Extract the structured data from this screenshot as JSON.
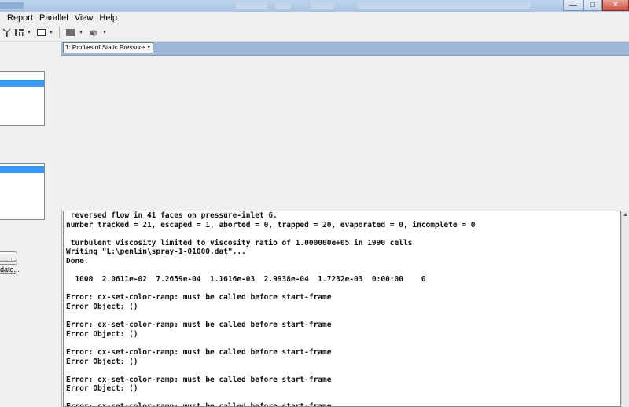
{
  "window": {
    "minimize_glyph": "—",
    "maximize_glyph": "□",
    "close_glyph": "✕"
  },
  "menu": [
    "Report",
    "Parallel",
    "View",
    "Help"
  ],
  "toolbar": {
    "dropdown_arrow": "▾"
  },
  "left_panel": {
    "button1_label": "...",
    "button2_label": "date..."
  },
  "graphics": {
    "view_selector_value": "1: Profiles of Static Pressure"
  },
  "console": {
    "lines": [
      " reversed flow in 41 faces on pressure-inlet 6.",
      "number tracked = 21, escaped = 1, aborted = 0, trapped = 20, evaporated = 0, incomplete = 0",
      "",
      " turbulent viscosity limited to viscosity ratio of 1.000000e+05 in 1990 cells",
      "Writing \"L:\\penlin\\spray-1-01000.dat\"...",
      "Done.",
      "",
      "  1000  2.0611e-02  7.2659e-04  1.1616e-03  2.9938e-04  1.7232e-03  0:00:00    0",
      "",
      "Error: cx-set-color-ramp: must be called before start-frame",
      "Error Object: ()",
      "",
      "Error: cx-set-color-ramp: must be called before start-frame",
      "Error Object: ()",
      "",
      "Error: cx-set-color-ramp: must be called before start-frame",
      "Error Object: ()",
      "",
      "Error: cx-set-color-ramp: must be called before start-frame",
      "Error Object: ()",
      "",
      "Error: cx-set-color-ramp: must be called before start-frame"
    ]
  },
  "icons": [
    "minimize-icon",
    "maximize-icon",
    "close-icon",
    "chevron-down-icon",
    "probe-icon",
    "layout-icon",
    "window-icon",
    "color-swatch-icon",
    "camera-icon"
  ]
}
